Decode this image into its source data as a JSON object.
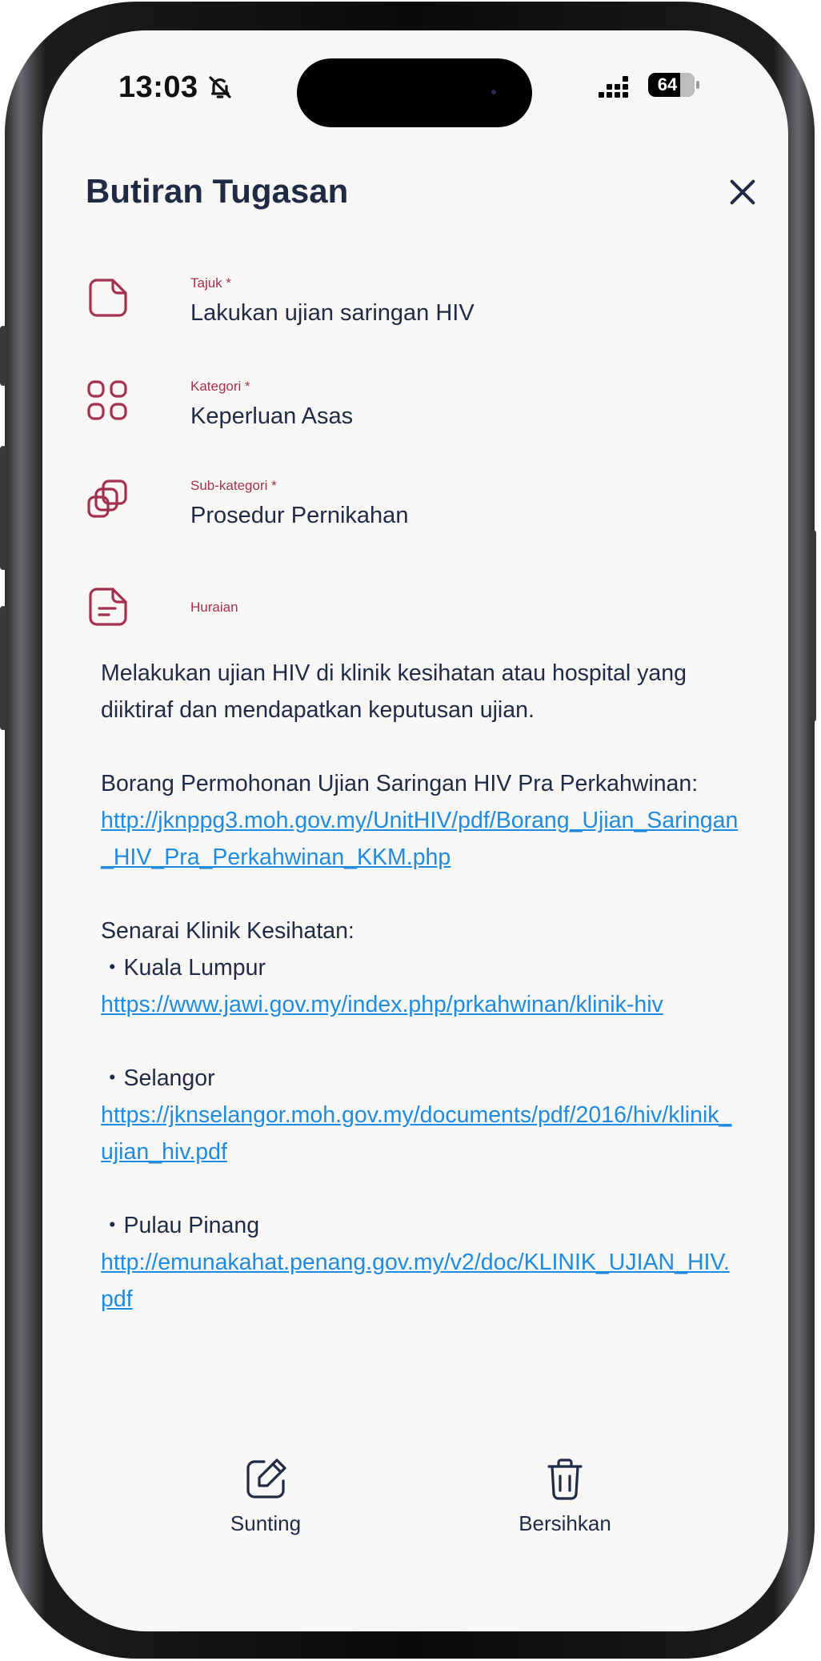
{
  "status_bar": {
    "time": "13:03",
    "battery": "64"
  },
  "header": {
    "title": "Butiran Tugasan"
  },
  "fields": {
    "title": {
      "label": "Tajuk *",
      "value": "Lakukan ujian saringan HIV"
    },
    "category": {
      "label": "Kategori *",
      "value": "Keperluan Asas"
    },
    "subcategory": {
      "label": "Sub-kategori *",
      "value": "Prosedur Pernikahan"
    },
    "description": {
      "label": "Huraian"
    }
  },
  "description": {
    "intro": "Melakukan ujian HIV di klinik kesihatan atau hospital yang diiktiraf dan mendapatkan keputusan ujian.",
    "form_heading": "Borang Permohonan Ujian Saringan HIV Pra Perkahwinan:",
    "form_link": "http://jknppg3.moh.gov.my/UnitHIV/pdf/Borang_Ujian_Saringan_HIV_Pra_Perkahwinan_KKM.php",
    "clinics_heading": "Senarai Klinik Kesihatan:",
    "clinics": [
      {
        "name": "・Kuala Lumpur",
        "link": "https://www.jawi.gov.my/index.php/prkahwinan/klinik-hiv"
      },
      {
        "name": "・Selangor",
        "link": "https://jknselangor.moh.gov.my/documents/pdf/2016/hiv/klinik_ujian_hiv.pdf"
      },
      {
        "name": "・Pulau Pinang",
        "link": "http://emunakahat.penang.gov.my/v2/doc/KLINIK_UJIAN_HIV.pdf"
      }
    ]
  },
  "actions": {
    "edit": "Sunting",
    "clear": "Bersihkan"
  },
  "colors": {
    "accent": "#a3304f",
    "text": "#1f2a44",
    "link": "#1e8ae0",
    "background": "#f8f7f5"
  }
}
